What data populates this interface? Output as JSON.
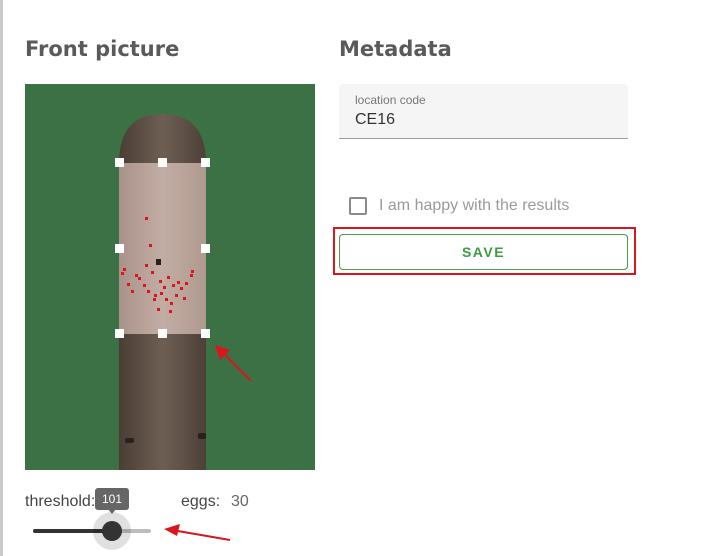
{
  "front": {
    "title": "Front picture"
  },
  "metadata": {
    "title": "Metadata",
    "location_label": "location code",
    "location_value": "CE16",
    "checkbox_label": "I am happy with the results",
    "checkbox_checked": false,
    "save_label": "SAVE"
  },
  "controls": {
    "threshold_label": "threshold: 101",
    "threshold_value": "101",
    "threshold_fraction": 0.67,
    "eggs_label": "eggs:",
    "eggs_value": "30"
  },
  "colors": {
    "background_green": "#3f7448",
    "save_text": "#3f9a45",
    "annotation_red": "#d9161c"
  }
}
